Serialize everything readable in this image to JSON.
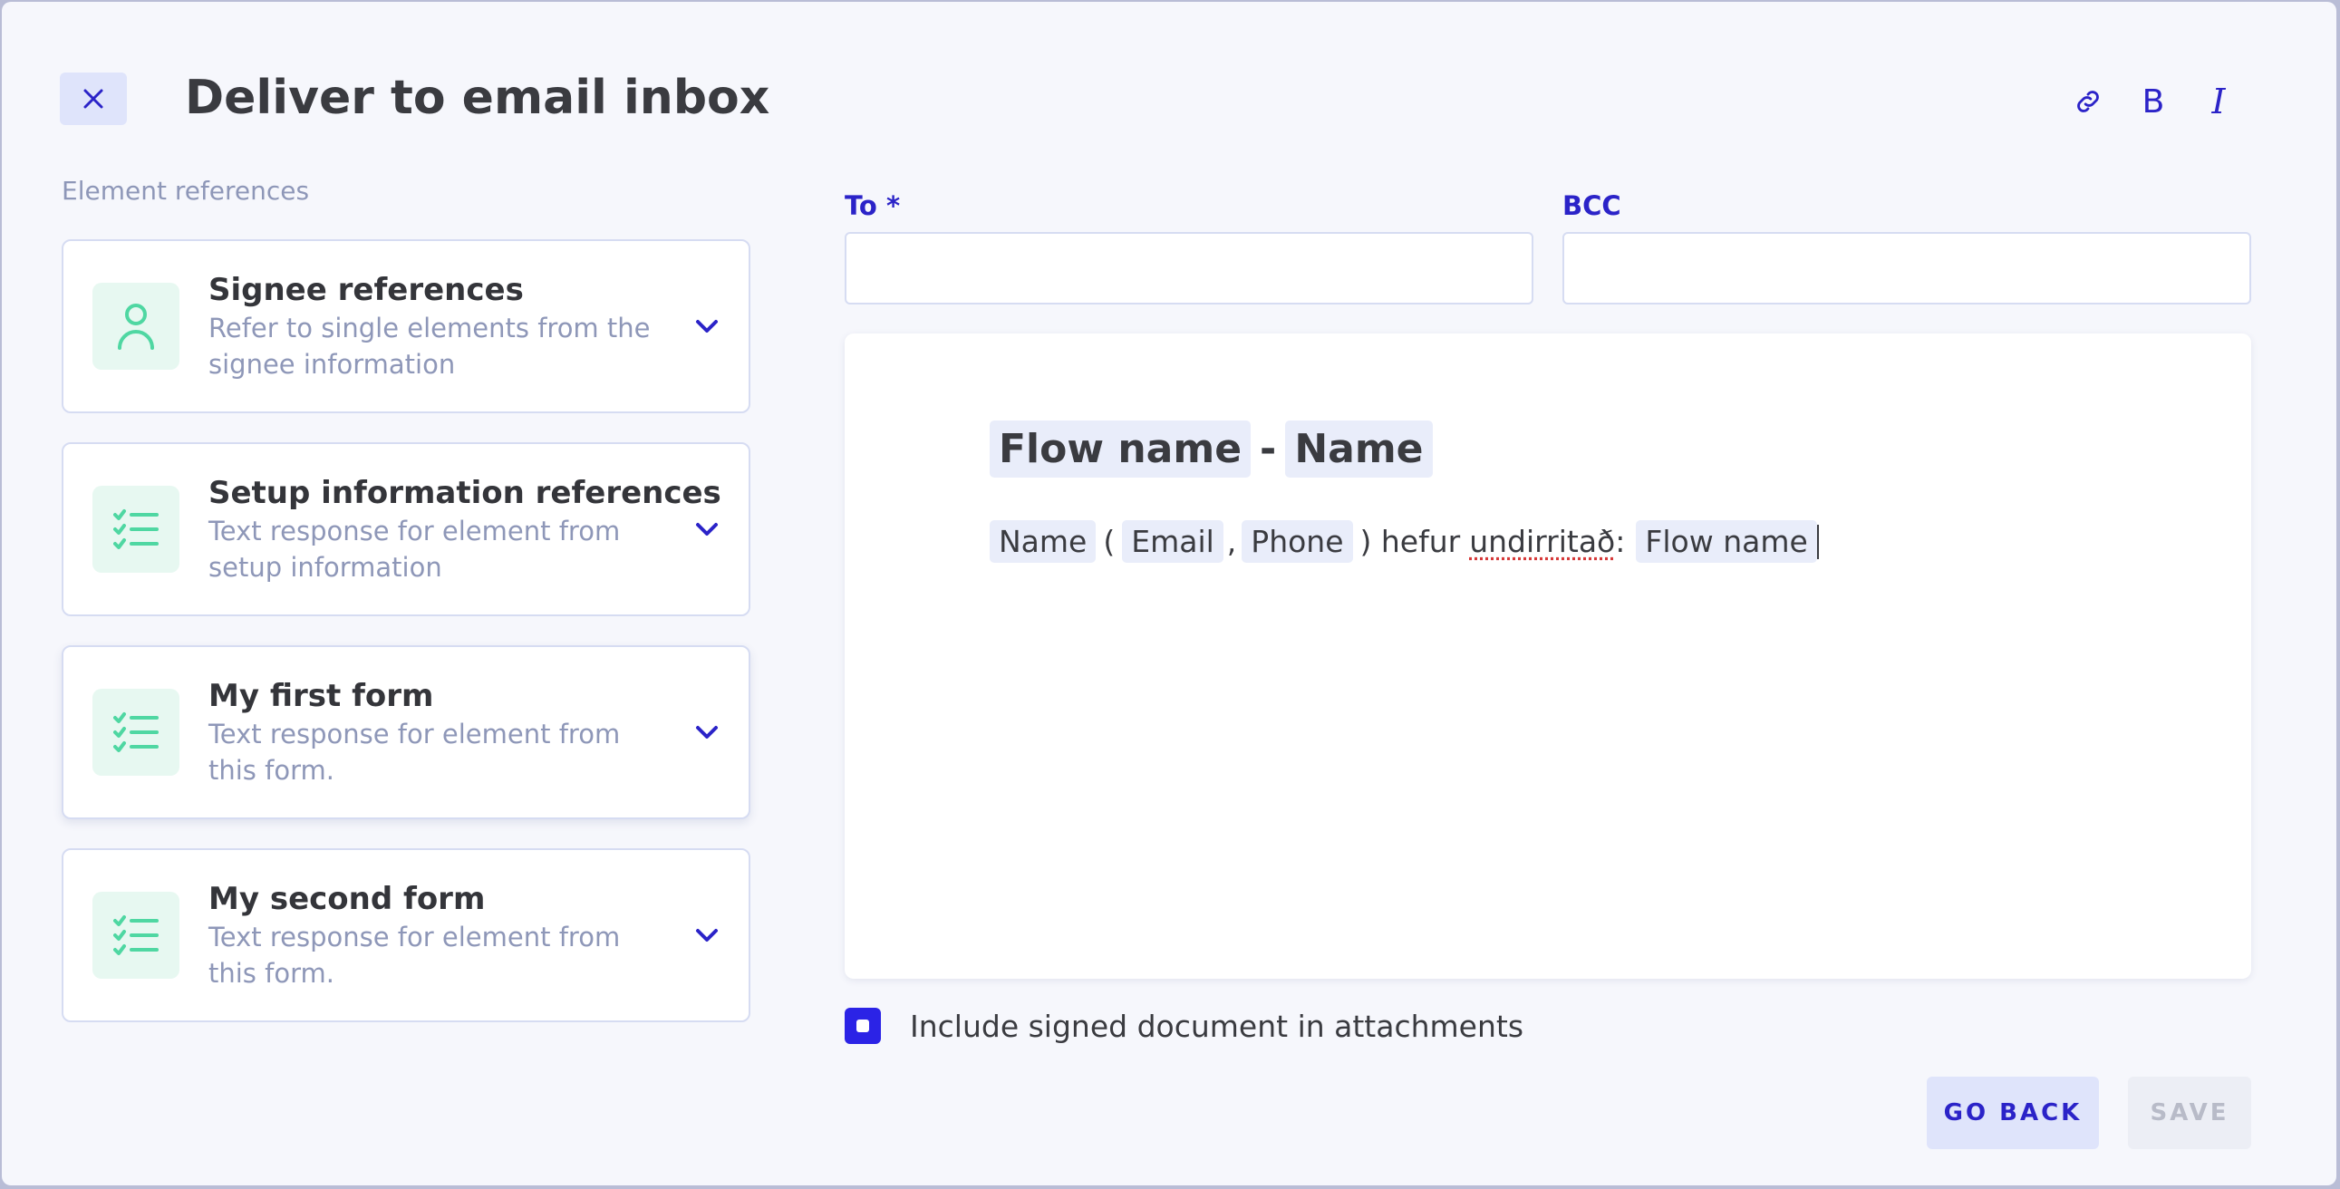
{
  "dialog": {
    "title": "Deliver to email inbox",
    "section_label": "Element references",
    "toolbar": {
      "bold": "B",
      "italic": "I"
    }
  },
  "references": [
    {
      "title": "Signee references",
      "description": "Refer to single elements from the signee information",
      "icon": "person-icon"
    },
    {
      "title": "Setup information references",
      "description": "Text response for element from setup information",
      "icon": "checklist-icon"
    },
    {
      "title": "My first form",
      "description": "Text response for element from this form.",
      "icon": "checklist-icon"
    },
    {
      "title": "My second form",
      "description": "Text response for element from this form.",
      "icon": "checklist-icon"
    }
  ],
  "fields": {
    "to": {
      "label": "To *",
      "value": ""
    },
    "bcc": {
      "label": "BCC",
      "value": ""
    }
  },
  "editor": {
    "heading": {
      "chip1": "Flow name",
      "separator": "-",
      "chip2": "Name"
    },
    "body": {
      "chip_name": "Name",
      "open_paren": "(",
      "chip_email": "Email",
      "comma": ",",
      "chip_phone": "Phone",
      "text_before": ") hefur",
      "misspelled_word": "undirritað",
      "colon": ":",
      "chip_flow": "Flow name"
    }
  },
  "attachment": {
    "label": "Include signed document in attachments",
    "checked": true
  },
  "actions": {
    "go_back": "GO BACK",
    "save": "SAVE"
  },
  "colors": {
    "accent": "#2b23e6",
    "link": "#2b23c8",
    "icon_green": "#4fd7a2",
    "chip_bg": "#e9edfa"
  }
}
